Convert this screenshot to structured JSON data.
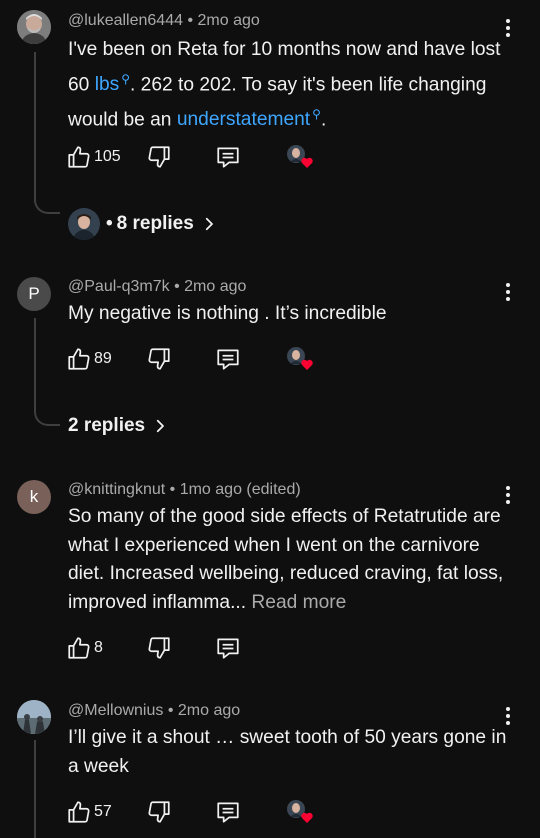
{
  "comments": [
    {
      "handle": "@lukeallen6444",
      "time": "2mo ago",
      "edited": "",
      "avatar_letter": "",
      "avatar_color": "#6b6b6b",
      "text_parts": [
        "I've been on Reta for 10 months now and have lost 60 ",
        "lbs",
        ". 262 to 202. To say it's been life changing would be an ",
        "understatement",
        "."
      ],
      "likes": "105",
      "replies": "8 replies"
    },
    {
      "handle": "@Paul-q3m7k",
      "time": "2mo ago",
      "edited": "",
      "avatar_letter": "P",
      "avatar_color": "#4a4a4a",
      "text": "My negative is nothing . It’s incredible",
      "likes": "89",
      "replies": "2 replies"
    },
    {
      "handle": "@knittingknut",
      "time": "1mo ago (edited)",
      "avatar_letter": "k",
      "avatar_color": "#79615a",
      "text": "So many of the good side effects of Retatrutide are what I experienced when I went on the carnivore diet.  Increased wellbeing, reduced craving, fat loss, improved inflamma...",
      "read_more": "Read more",
      "likes": "8"
    },
    {
      "handle": "@Mellownius",
      "time": "2mo ago",
      "avatar_letter": "",
      "avatar_color": "#7f93a6",
      "text": "I’ll give it a shout … sweet tooth of 50 years gone in a week",
      "likes": "57"
    }
  ],
  "separator": "•",
  "icons": {
    "like": "thumbs-up-icon",
    "dislike": "thumbs-down-icon",
    "reply": "comment-icon",
    "menu": "more-vert-icon",
    "creator_heart": "creator-heart-icon",
    "chevron": "chevron-right-icon",
    "search": "search-icon"
  },
  "colors": {
    "background": "#0f0f0f",
    "text": "#f1f1f1",
    "muted": "#aaaaaa",
    "link": "#3ea6ff",
    "heart": "#ff0033"
  }
}
